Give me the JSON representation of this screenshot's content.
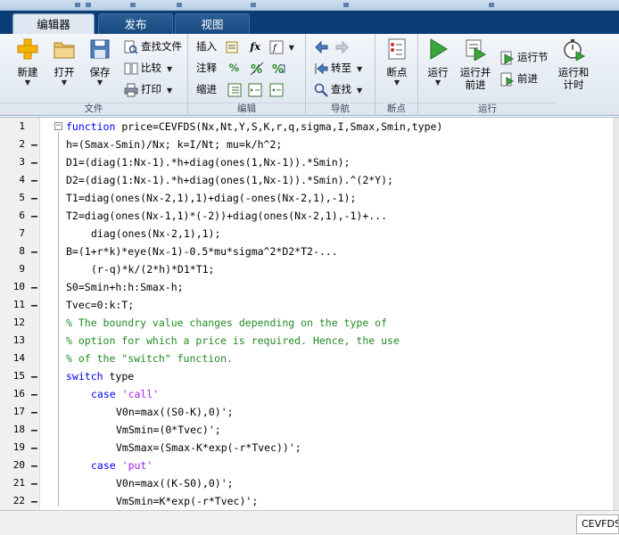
{
  "ribbon_tabs": [
    {
      "label": "编辑器",
      "active": true
    },
    {
      "label": "发布",
      "active": false
    },
    {
      "label": "视图",
      "active": false
    }
  ],
  "groups": {
    "file": {
      "label": "文件",
      "new": "新建",
      "open": "打开",
      "save": "保存",
      "find_files": "查找文件",
      "compare": "比较",
      "print": "打印"
    },
    "edit": {
      "label": "编辑",
      "insert": "插入",
      "comment": "注释",
      "indent": "缩进",
      "fx": "fx"
    },
    "navigate": {
      "label": "导航",
      "goto": "转至",
      "find": "查找"
    },
    "breakpoints": {
      "label": "断点",
      "breakpoints": "断点"
    },
    "run": {
      "label": "运行",
      "run": "运行",
      "run_advance_1": "运行并",
      "run_advance_2": "前进",
      "run_section": "运行节",
      "advance": "前进",
      "run_time_1": "运行和",
      "run_time_2": "计时"
    }
  },
  "editor": {
    "lines": [
      {
        "n": "1",
        "dash": "",
        "parts": [
          {
            "t": "function",
            "c": "kw"
          },
          {
            "t": " price=CEVFDS(Nx,Nt,Y,S,K,r,q,sigma,I,Smax,Smin,type)",
            "c": ""
          }
        ],
        "indent": 0
      },
      {
        "n": "2",
        "dash": "–",
        "parts": [
          {
            "t": "h=(Smax-Smin)/Nx; k=I/Nt; mu=k/h^2;",
            "c": ""
          }
        ],
        "indent": 0
      },
      {
        "n": "3",
        "dash": "–",
        "parts": [
          {
            "t": "D1=(diag(1:Nx-1).*h+diag(ones(1,Nx-1)).*Smin);",
            "c": ""
          }
        ],
        "indent": 0
      },
      {
        "n": "4",
        "dash": "–",
        "parts": [
          {
            "t": "D2=(diag(1:Nx-1).*h+diag(ones(1,Nx-1)).*Smin).^(2*Y);",
            "c": ""
          }
        ],
        "indent": 0
      },
      {
        "n": "5",
        "dash": "–",
        "parts": [
          {
            "t": "T1=diag(ones(Nx-2,1),1)+diag(-ones(Nx-2,1),-1);",
            "c": ""
          }
        ],
        "indent": 0
      },
      {
        "n": "6",
        "dash": "–",
        "parts": [
          {
            "t": "T2=diag(ones(Nx-1,1)*(-2))+diag(ones(Nx-2,1),-1)+...",
            "c": ""
          }
        ],
        "indent": 0
      },
      {
        "n": "7",
        "dash": "",
        "parts": [
          {
            "t": "diag(ones(Nx-2,1),1);",
            "c": ""
          }
        ],
        "indent": 1
      },
      {
        "n": "8",
        "dash": "–",
        "parts": [
          {
            "t": "B=(1+r*k)*eye(Nx-1)-0.5*mu*sigma^2*D2*T2-...",
            "c": ""
          }
        ],
        "indent": 0
      },
      {
        "n": "9",
        "dash": "",
        "parts": [
          {
            "t": "(r-q)*k/(2*h)*D1*T1;",
            "c": ""
          }
        ],
        "indent": 1
      },
      {
        "n": "10",
        "dash": "–",
        "parts": [
          {
            "t": "S0=Smin+h:h:Smax-h;",
            "c": ""
          }
        ],
        "indent": 0
      },
      {
        "n": "11",
        "dash": "–",
        "parts": [
          {
            "t": "Tvec=0:k:T;",
            "c": ""
          }
        ],
        "indent": 0
      },
      {
        "n": "12",
        "dash": "",
        "parts": [
          {
            "t": "% The boundry value changes depending on the type of",
            "c": "cmt"
          }
        ],
        "indent": 0
      },
      {
        "n": "13",
        "dash": "",
        "parts": [
          {
            "t": "% option for which a price is required. Hence, the use",
            "c": "cmt"
          }
        ],
        "indent": 0
      },
      {
        "n": "14",
        "dash": "",
        "parts": [
          {
            "t": "% of the \"switch\" function.",
            "c": "cmt"
          }
        ],
        "indent": 0
      },
      {
        "n": "15",
        "dash": "–",
        "parts": [
          {
            "t": "switch",
            "c": "kw"
          },
          {
            "t": " type",
            "c": ""
          }
        ],
        "indent": 0
      },
      {
        "n": "16",
        "dash": "–",
        "parts": [
          {
            "t": "case",
            "c": "kw"
          },
          {
            "t": " ",
            "c": ""
          },
          {
            "t": "'call'",
            "c": "str"
          }
        ],
        "indent": 1
      },
      {
        "n": "17",
        "dash": "–",
        "parts": [
          {
            "t": "V0n=max((S0-K),0)';",
            "c": ""
          }
        ],
        "indent": 2
      },
      {
        "n": "18",
        "dash": "–",
        "parts": [
          {
            "t": "VmSmin=(0*Tvec)';",
            "c": ""
          }
        ],
        "indent": 2
      },
      {
        "n": "19",
        "dash": "–",
        "parts": [
          {
            "t": "VmSmax=(Smax-K*exp(-r*Tvec))';",
            "c": ""
          }
        ],
        "indent": 2
      },
      {
        "n": "20",
        "dash": "–",
        "parts": [
          {
            "t": "case",
            "c": "kw"
          },
          {
            "t": " ",
            "c": ""
          },
          {
            "t": "'put'",
            "c": "str"
          }
        ],
        "indent": 1
      },
      {
        "n": "21",
        "dash": "–",
        "parts": [
          {
            "t": "V0n=max((K-S0),0)';",
            "c": ""
          }
        ],
        "indent": 2
      },
      {
        "n": "22",
        "dash": "–",
        "parts": [
          {
            "t": "VmSmin=K*exp(-r*Tvec)';",
            "c": ""
          }
        ],
        "indent": 2
      }
    ]
  },
  "status": {
    "function_name": "CEVFDS"
  },
  "colors": {
    "keyword": "#0000ff",
    "string": "#a020f0",
    "comment": "#228b22",
    "tab_bar": "#0a3d74"
  }
}
